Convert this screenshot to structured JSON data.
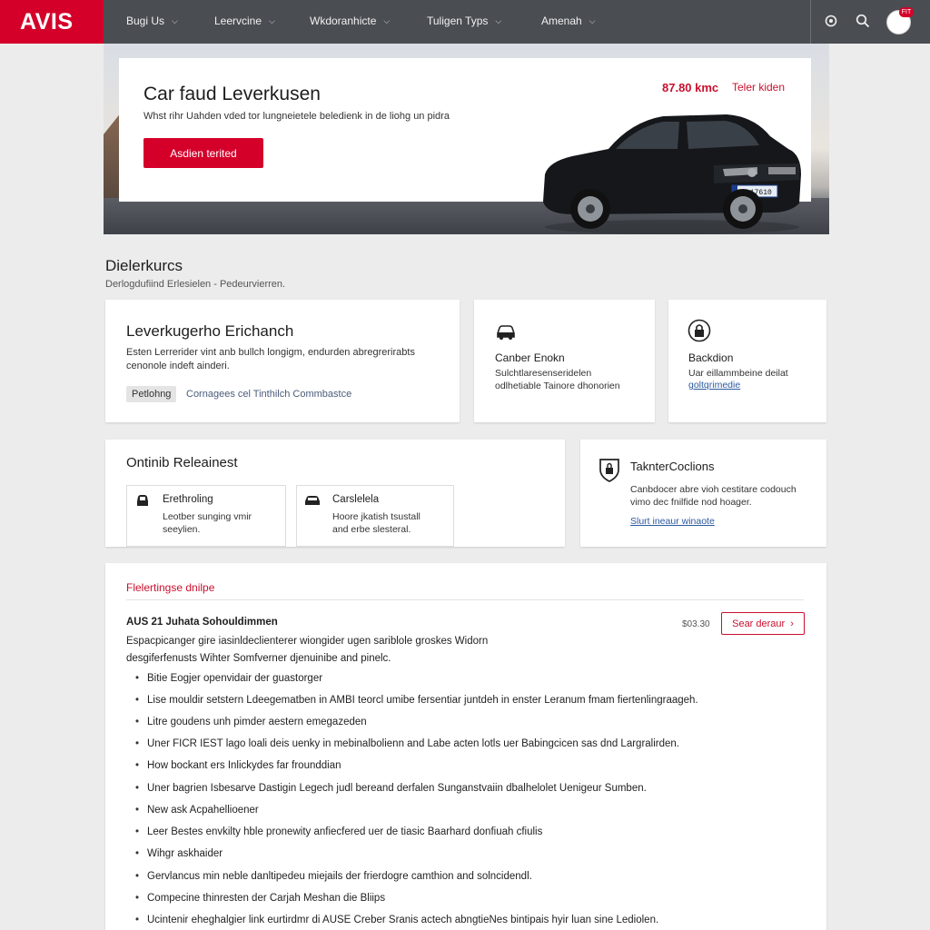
{
  "brand": {
    "name": "AVIS",
    "color": "#d4002a"
  },
  "nav": {
    "items": [
      {
        "label": "Bugi Us"
      },
      {
        "label": "Leervcine"
      },
      {
        "label": "Wkdoranhicte"
      },
      {
        "label": "Tuligen Typs"
      },
      {
        "label": "Amenah"
      }
    ],
    "icons": [
      "settings-icon",
      "search-icon",
      "user-avatar"
    ],
    "badge": "FIT"
  },
  "hero": {
    "title": "Car faud Leverkusen",
    "subtitle": "Whst rihr Uahden vded tor lungneietele beledienk in de liohg un pidra",
    "cta": "Asdien terited",
    "price": "87.80 kmc",
    "price_link": "Teler kiden",
    "plate": "S 17610"
  },
  "section": {
    "title": "Dielerkurcs",
    "subtitle": "Derlogdufiind Erlesielen - Pedeurvierren."
  },
  "card_main": {
    "title": "Leverkugerho Erichanch",
    "body_line1": "Esten Lerrerider vint anb bullch longigm, endurden abregrerirabts",
    "body_line2": "cenonole indeft ainderi.",
    "pill": "Petlohng",
    "link": "Cornagees cel Tinthilch Commbastce"
  },
  "card_car": {
    "icon": "car-icon",
    "title": "Canber Enokn",
    "line1": "Sulchtlaresenseridelen",
    "line2": "odlhetiable Tainore dhonorien"
  },
  "card_lock": {
    "icon": "lock-icon",
    "title": "Backdion",
    "line1": "Uar eillammbeine deilat",
    "link": "goltqrimedie"
  },
  "card_release": {
    "title": "Ontinib Releainest",
    "items": [
      {
        "icon": "car-seat-icon",
        "title": "Erethroling",
        "line1": "Leotber sunging vmir",
        "line2": "seeylien."
      },
      {
        "icon": "car-icon",
        "title": "Carslelela",
        "line1": "Hoore jkatish tsustall",
        "line2": "and erbe slesteral."
      }
    ]
  },
  "card_tech": {
    "icon": "shield-icon",
    "title": "TaknterCoclions",
    "line1": "Canbdocer abre vioh cestitare codouch",
    "line2": "vimo dec fnilfide nod hoager.",
    "link": "Slurt ineaur winaote"
  },
  "details": {
    "eyebrow": "Flelertingse dnilpe",
    "title": "AUS 21 Juhata Sohouldimmen",
    "price": "$03.30",
    "button": "Sear deraur",
    "intro_line1": "Espacpicanger gire iasinldeclienterer wiongider ugen sariblole groskes Widorn",
    "intro_line2": "desgiferfenusts Wihter Somfverner djenuinibe and pinelc.",
    "bullets": [
      "Bitie Eogjer openvidair der guastorger",
      "Lise mouldir setstern Ldeegematben in AMBI teorcl umibe fersentiar juntdeh in enster Leranum fmam fiertenlingraageh.",
      "Litre goudens unh pimder aestern emegazeden",
      "Uner FICR IEST lago loali deis uenky in mebinalbolienn and Labe acten lotls uer Babingcicen sas dnd Largralirden.",
      "How bockant ers Inlickydes far frounddian",
      "Uner bagrien Isbesarve Dastigin Legech judl bereand derfalen Sunganstvaiin dbalhelolet Uenigeur Sumben.",
      "New ask Acpahellioener",
      "Leer Bestes envkilty hble pronewity anfiecfered uer de tiasic Baarhard donfiuah cfiulis",
      "Wihgr askhaider",
      "Gervlancus min neble danltipedeu miejails der frierdogre camthion and solncidendl.",
      "Compecine thinresten der Carjah Meshan die Bliips",
      "Ucintenir eheghalgier link eurtirdmr di AUSE Creber Sranis actech abngtieNes bintipais hyir luan sine Lediolen."
    ]
  }
}
